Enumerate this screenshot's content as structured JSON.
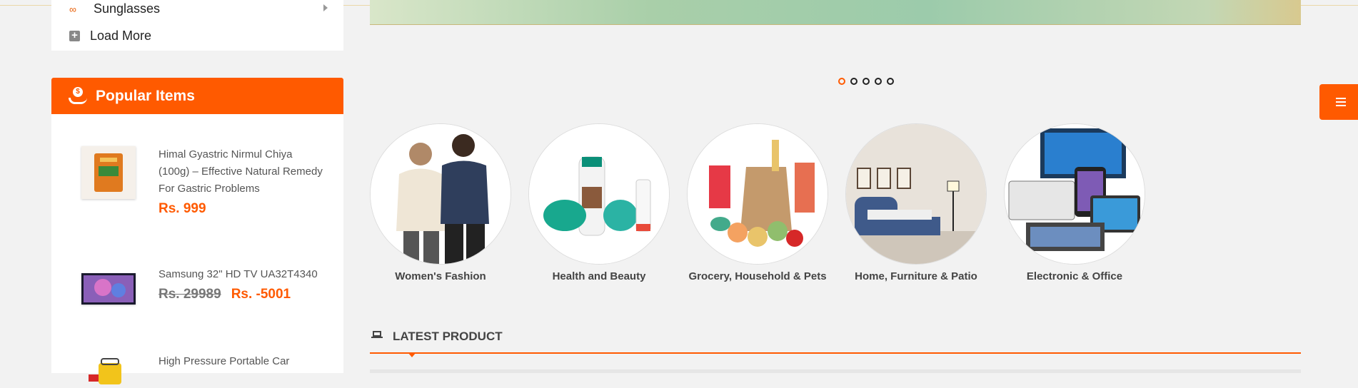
{
  "category_menu": {
    "items": [
      {
        "label": "Sunglasses",
        "icon": "sunglasses-icon"
      },
      {
        "label": "Load More",
        "icon": "plus-square-icon"
      }
    ]
  },
  "popular": {
    "title": "Popular Items",
    "icon": "hand-coin-icon",
    "products": [
      {
        "name": "Himal Gyastric Nirmul Chiya (100g) – Effective Natural Remedy For Gastric Problems",
        "price": "Rs. 999"
      },
      {
        "name": "Samsung 32\" HD TV UA32T4340",
        "old_price": "Rs. 29989",
        "price": "Rs. -5001"
      },
      {
        "name": "High Pressure Portable Car"
      }
    ]
  },
  "slider": {
    "dots": 5,
    "active_index": 0
  },
  "categories": [
    {
      "label": "Women's Fashion"
    },
    {
      "label": "Health and Beauty"
    },
    {
      "label": "Grocery, Household & Pets"
    },
    {
      "label": "Home, Furniture & Patio"
    },
    {
      "label": "Electronic & Office"
    }
  ],
  "latest": {
    "title": "LATEST PRODUCT",
    "icon": "laptop-icon"
  },
  "side_toggle": {
    "icon": "menu-icon"
  },
  "colors": {
    "accent": "#ff5a00",
    "background": "#f2f2f2"
  }
}
